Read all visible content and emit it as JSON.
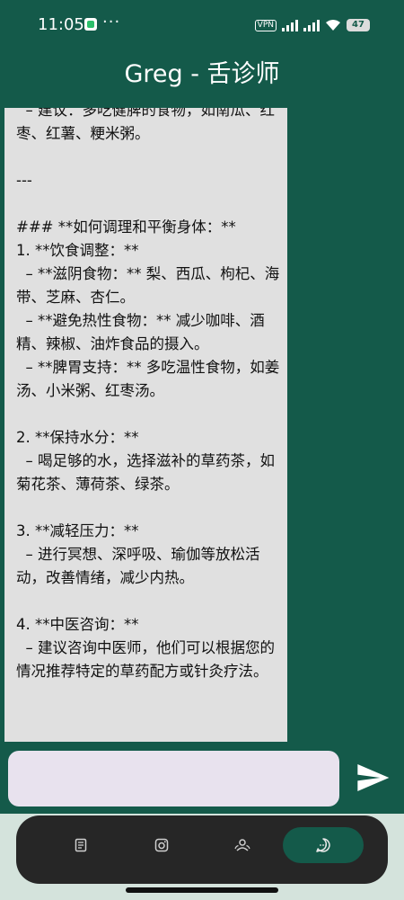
{
  "status_bar": {
    "time": "11:05",
    "more": "···",
    "vpn": "VPN",
    "battery": "47"
  },
  "header": {
    "title": "Greg - 舌诊师"
  },
  "chat": {
    "message": "  – 建议：多吃健脾的食物，如南瓜、红枣、红薯、粳米粥。\n\n---\n\n### **如何调理和平衡身体：**\n1. **饮食调整：**\n  – **滋阴食物：** 梨、西瓜、枸杞、海带、芝麻、杏仁。\n  – **避免热性食物：** 减少咖啡、酒精、辣椒、油炸食品的摄入。\n  – **脾胃支持：** 多吃温性食物，如姜汤、小米粥、红枣汤。\n\n2. **保持水分：**\n  – 喝足够的水，选择滋补的草药茶，如菊花茶、薄荷茶、绿茶。\n\n3. **减轻压力：**\n  – 进行冥想、深呼吸、瑜伽等放松活动，改善情绪，减少内热。\n\n4. **中医咨询：**\n  – 建议咨询中医师，他们可以根据您的情况推荐特定的草药配方或针灸疗法。"
  },
  "composer": {
    "input_value": "",
    "placeholder": ""
  },
  "nav": {
    "items": [
      {
        "icon": "notes-icon",
        "active": false
      },
      {
        "icon": "camera-icon",
        "active": false
      },
      {
        "icon": "users-icon",
        "active": false
      },
      {
        "icon": "chat-icon",
        "active": true
      }
    ]
  },
  "colors": {
    "primary": "#145a4a",
    "bubble": "#e0e0e0",
    "input": "#e8e2ee",
    "nav_bar": "#262626"
  }
}
